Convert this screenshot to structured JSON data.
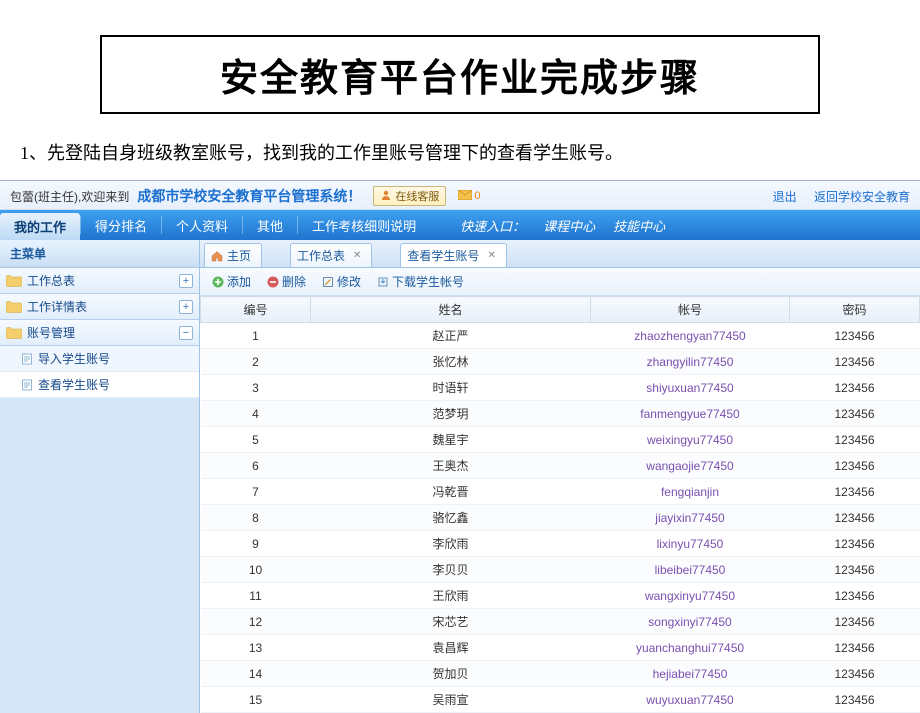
{
  "page_title": "安全教育平台作业完成步骤",
  "instruction": "1、先登陆自身班级教室账号，找到我的工作里账号管理下的查看学生账号。",
  "header": {
    "welcome_prefix": "包蕾(班主任),欢迎来到",
    "system_name": "成都市学校安全教育平台管理系统！",
    "cs_label": "在线客服",
    "mail_count": "0",
    "logout": "退出",
    "back_link": "返回学校安全教育"
  },
  "menu": {
    "items": [
      "我的工作",
      "得分排名",
      "个人资料",
      "其他",
      "工作考核细则说明"
    ],
    "active_index": 0,
    "quick_label": "快速入口：",
    "quick_items": [
      "课程中心",
      "技能中心"
    ]
  },
  "sidebar": {
    "header": "主菜单",
    "sections": [
      {
        "label": "工作总表",
        "expanded": false,
        "children": []
      },
      {
        "label": "工作详情表",
        "expanded": false,
        "children": []
      },
      {
        "label": "账号管理",
        "expanded": true,
        "children": [
          {
            "label": "导入学生账号",
            "selected": false
          },
          {
            "label": "查看学生账号",
            "selected": true
          }
        ]
      }
    ]
  },
  "tabs": {
    "items": [
      {
        "label": "主页",
        "icon": "home",
        "closable": false,
        "active": false
      },
      {
        "label": "工作总表",
        "icon": "none",
        "closable": true,
        "active": false
      },
      {
        "label": "查看学生账号",
        "icon": "none",
        "closable": true,
        "active": true
      }
    ]
  },
  "toolbar": {
    "add": "添加",
    "delete": "删除",
    "edit": "修改",
    "download": "下载学生帐号"
  },
  "grid": {
    "columns": [
      "编号",
      "姓名",
      "帐号",
      "密码"
    ],
    "rows": [
      {
        "id": "1",
        "name": "赵正严",
        "acct": "zhaozhengyan77450",
        "pwd": "123456"
      },
      {
        "id": "2",
        "name": "张忆林",
        "acct": "zhangyilin77450",
        "pwd": "123456"
      },
      {
        "id": "3",
        "name": "时语轩",
        "acct": "shiyuxuan77450",
        "pwd": "123456"
      },
      {
        "id": "4",
        "name": "范梦玥",
        "acct": "fanmengyue77450",
        "pwd": "123456"
      },
      {
        "id": "5",
        "name": "魏星宇",
        "acct": "weixingyu77450",
        "pwd": "123456"
      },
      {
        "id": "6",
        "name": "王奥杰",
        "acct": "wangaojie77450",
        "pwd": "123456"
      },
      {
        "id": "7",
        "name": "冯乾晋",
        "acct": "fengqianjin",
        "pwd": "123456"
      },
      {
        "id": "8",
        "name": "骆忆鑫",
        "acct": "jiayixin77450",
        "pwd": "123456"
      },
      {
        "id": "9",
        "name": "李欣雨",
        "acct": "lixinyu77450",
        "pwd": "123456"
      },
      {
        "id": "10",
        "name": "李贝贝",
        "acct": "libeibei77450",
        "pwd": "123456"
      },
      {
        "id": "11",
        "name": "王欣雨",
        "acct": "wangxinyu77450",
        "pwd": "123456"
      },
      {
        "id": "12",
        "name": "宋芯艺",
        "acct": "songxinyi77450",
        "pwd": "123456"
      },
      {
        "id": "13",
        "name": "袁昌辉",
        "acct": "yuanchanghui77450",
        "pwd": "123456"
      },
      {
        "id": "14",
        "name": "贺加贝",
        "acct": "hejiabei77450",
        "pwd": "123456"
      },
      {
        "id": "15",
        "name": "吴雨宣",
        "acct": "wuyuxuan77450",
        "pwd": "123456"
      }
    ]
  }
}
